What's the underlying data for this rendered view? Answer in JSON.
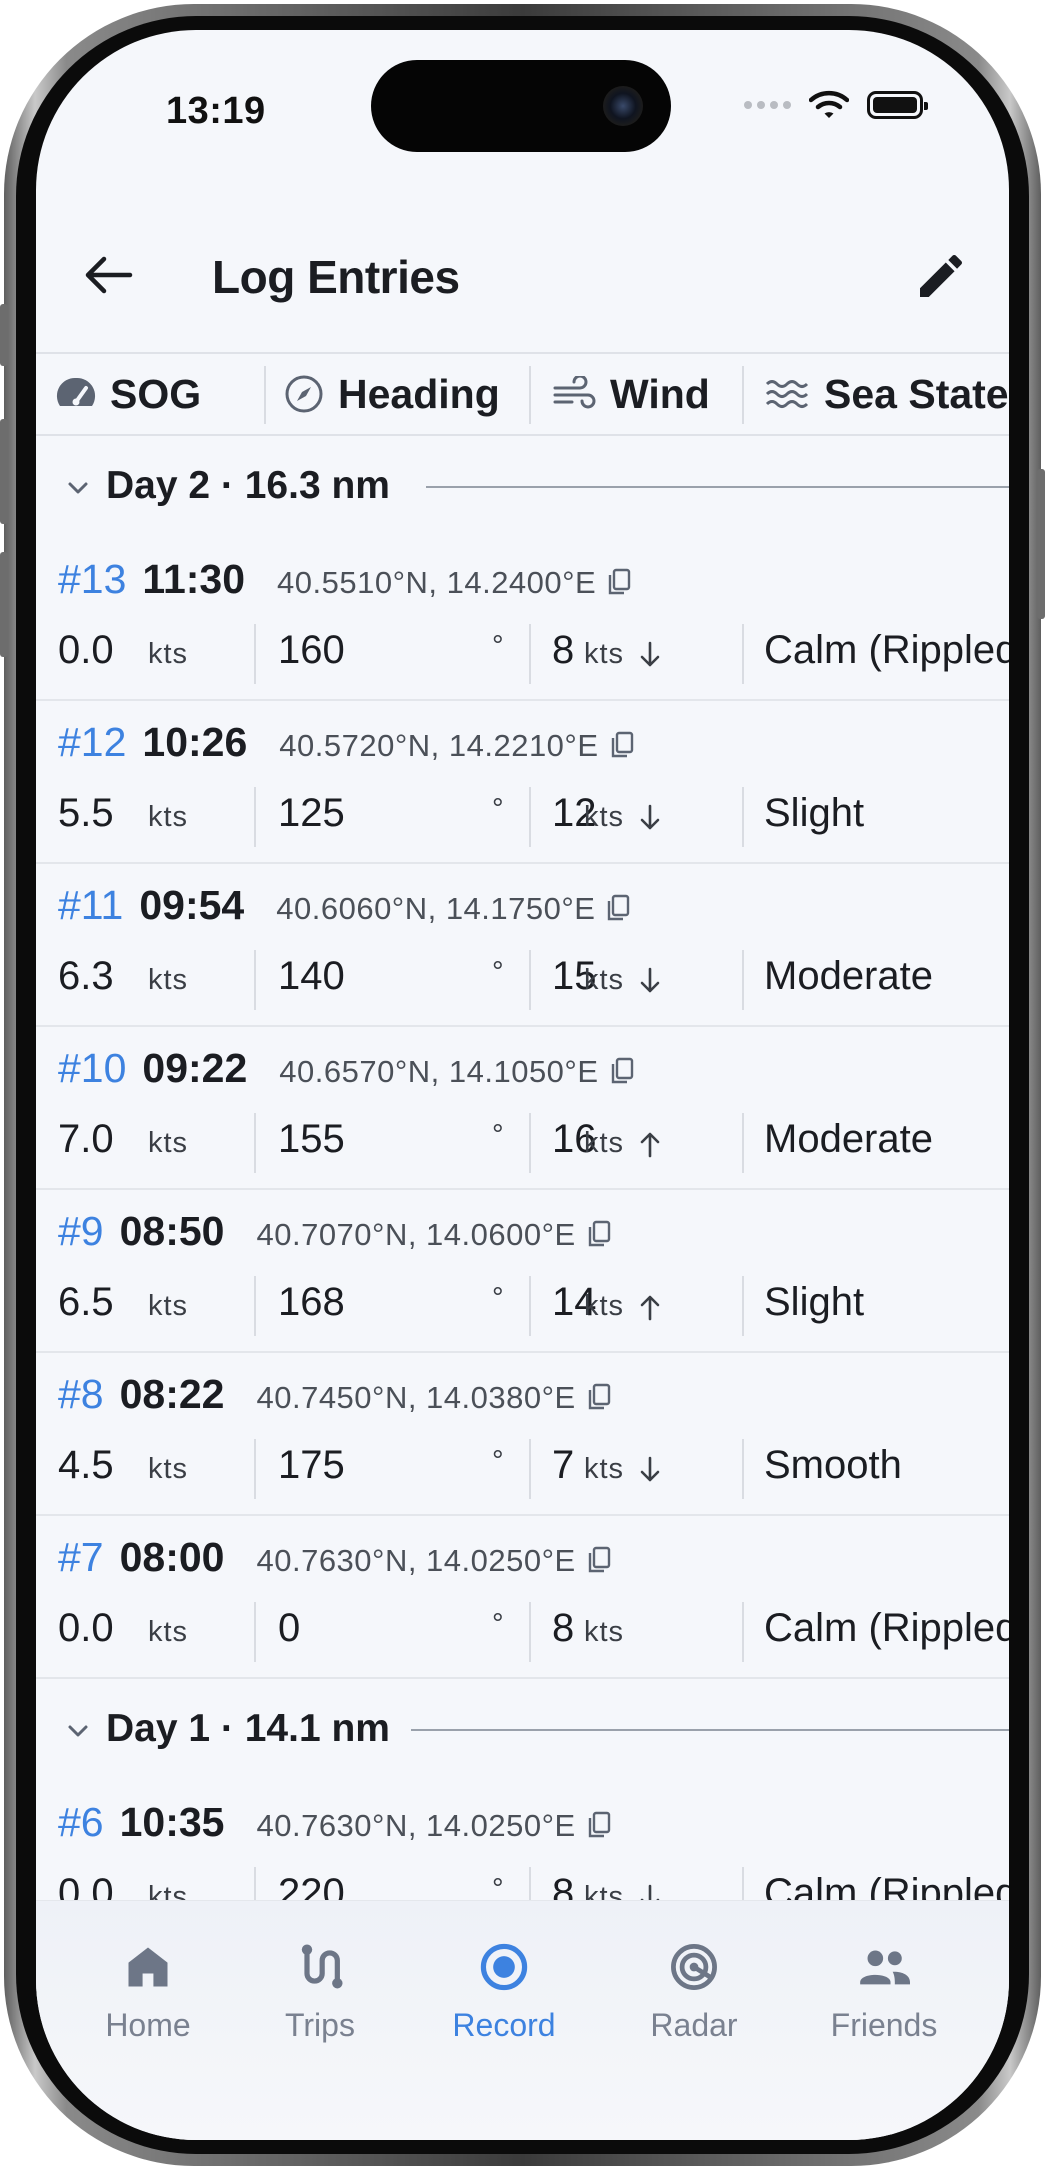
{
  "status": {
    "time": "13:19"
  },
  "appbar": {
    "title": "Log Entries"
  },
  "columns": [
    {
      "label": "SOG",
      "icon": "speedometer-icon"
    },
    {
      "label": "Heading",
      "icon": "compass-icon"
    },
    {
      "label": "Wind",
      "icon": "wind-icon"
    },
    {
      "label": "Sea State",
      "icon": "waves-icon"
    }
  ],
  "days": [
    {
      "label": "Day 2 · 16.3 nm",
      "expanded": true
    },
    {
      "label": "Day 1 · 14.1 nm",
      "expanded": true
    }
  ],
  "units": {
    "speed": "kts",
    "degree": "°"
  },
  "entries": [
    {
      "num": "#13",
      "time": "11:30",
      "coord": "40.5510°N, 14.2400°E",
      "sog": "0.0",
      "heading": "160",
      "wind": "8",
      "wind_dir": "down",
      "sea": "Calm (Rippled)"
    },
    {
      "num": "#12",
      "time": "10:26",
      "coord": "40.5720°N, 14.2210°E",
      "sog": "5.5",
      "heading": "125",
      "wind": "12",
      "wind_dir": "down",
      "sea": "Slight"
    },
    {
      "num": "#11",
      "time": "09:54",
      "coord": "40.6060°N, 14.1750°E",
      "sog": "6.3",
      "heading": "140",
      "wind": "15",
      "wind_dir": "down",
      "sea": "Moderate"
    },
    {
      "num": "#10",
      "time": "09:22",
      "coord": "40.6570°N, 14.1050°E",
      "sog": "7.0",
      "heading": "155",
      "wind": "16",
      "wind_dir": "up",
      "sea": "Moderate"
    },
    {
      "num": "#9",
      "time": "08:50",
      "coord": "40.7070°N, 14.0600°E",
      "sog": "6.5",
      "heading": "168",
      "wind": "14",
      "wind_dir": "up",
      "sea": "Slight"
    },
    {
      "num": "#8",
      "time": "08:22",
      "coord": "40.7450°N, 14.0380°E",
      "sog": "4.5",
      "heading": "175",
      "wind": "7",
      "wind_dir": "down",
      "sea": "Smooth"
    },
    {
      "num": "#7",
      "time": "08:00",
      "coord": "40.7630°N, 14.0250°E",
      "sog": "0.0",
      "heading": "0",
      "wind": "8",
      "wind_dir": "",
      "sea": "Calm (Rippled)"
    },
    {
      "num": "#6",
      "time": "10:35",
      "coord": "40.7630°N, 14.0250°E",
      "sog": "0.0",
      "heading": "220",
      "wind": "8",
      "wind_dir": "down",
      "sea": "Calm (Rippled)"
    }
  ],
  "nav": [
    {
      "label": "Home",
      "icon": "home-icon",
      "active": false
    },
    {
      "label": "Trips",
      "icon": "route-icon",
      "active": false
    },
    {
      "label": "Record",
      "icon": "record-icon",
      "active": true
    },
    {
      "label": "Radar",
      "icon": "radar-icon",
      "active": false
    },
    {
      "label": "Friends",
      "icon": "people-icon",
      "active": false
    }
  ],
  "colors": {
    "accent": "#3d82e0",
    "text": "#1b1d22",
    "muted": "#7a8190",
    "background": "#f5f7fb"
  }
}
